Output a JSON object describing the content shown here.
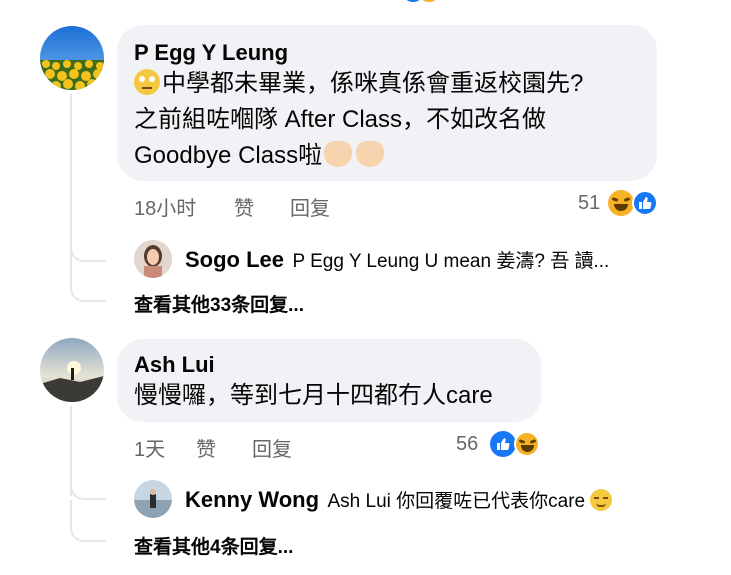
{
  "comments": [
    {
      "author": "P Egg Y Leung",
      "lines": [
        "中學都未畢業，係咪真係會重返校園先?",
        "之前組咗嗰隊 After Class，不如改名做",
        "Goodbye Class啦"
      ],
      "time": "18小时",
      "like": "赞",
      "reply": "回复",
      "reaction_count": "51",
      "reactions": [
        "laugh-icon",
        "like-icon"
      ],
      "first_reply": {
        "author": "Sogo Lee",
        "text": "P Egg Y Leung U mean 姜濤?  吾 讀..."
      },
      "more_replies": "查看其他33条回复..."
    },
    {
      "author": "Ash Lui",
      "lines": [
        "慢慢囉，等到七月十四都冇人care"
      ],
      "time": "1天",
      "like": "赞",
      "reply": "回复",
      "reaction_count": "56",
      "reactions": [
        "like-icon",
        "laugh-icon"
      ],
      "first_reply": {
        "author": "Kenny Wong",
        "text": "Ash Lui 你回覆咗已代表你care"
      },
      "more_replies": "查看其他4条回复..."
    }
  ],
  "colors": {
    "bubble": "#f0f2f5",
    "secondary_text": "#65676b",
    "like_blue": "#1877f2",
    "laugh_yellow": "#f7b125"
  }
}
